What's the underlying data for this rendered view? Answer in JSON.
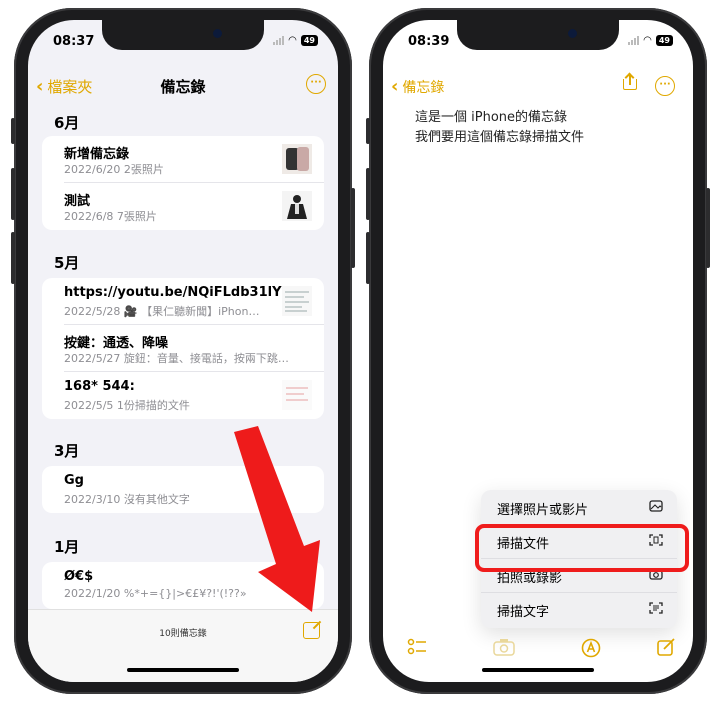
{
  "left": {
    "status_time": "08:37",
    "battery": "49",
    "back_label": "檔案夾",
    "title": "備忘錄",
    "sections": [
      {
        "month": "6月",
        "notes": [
          {
            "title": "新增備忘錄",
            "sub": "2022/6/20  2張照片",
            "thumb": "backpack"
          },
          {
            "title": "測試",
            "sub": "2022/6/8  7張照片",
            "thumb": "person"
          }
        ]
      },
      {
        "month": "5月",
        "notes": [
          {
            "title": "https://youtu.be/NQiFLdb31lY",
            "sub": "2022/5/28  🎥 【果仁聽新聞】iPhon…",
            "thumb": "doc"
          },
          {
            "title": "按鍵：通透、降噪",
            "sub": "2022/5/27  旋鈕：音量、接電話，按兩下跳…",
            "thumb": ""
          },
          {
            "title": "168* 544:",
            "sub": "2022/5/5  1份掃描的文件",
            "thumb": "scan"
          }
        ]
      },
      {
        "month": "3月",
        "notes": [
          {
            "title": "Gg",
            "sub": "2022/3/10  沒有其他文字",
            "thumb": ""
          }
        ]
      },
      {
        "month": "1月",
        "notes": [
          {
            "title": "Ø€$",
            "sub": "2022/1/20  %*+={}|>€£¥?!'(!??»",
            "thumb": ""
          }
        ]
      }
    ],
    "note_count": "10則備忘錄"
  },
  "right": {
    "status_time": "08:39",
    "battery": "49",
    "back_label": "備忘錄",
    "body_lines": [
      "這是一個 iPhone的備忘錄",
      "我們要用這個備忘錄掃描文件"
    ],
    "menu": [
      {
        "label": "選擇照片或影片",
        "icon": "photo-library-icon"
      },
      {
        "label": "掃描文件",
        "icon": "document-scan-icon"
      },
      {
        "label": "拍照或錄影",
        "icon": "camera-icon"
      },
      {
        "label": "掃描文字",
        "icon": "text-scan-icon"
      }
    ]
  },
  "colors": {
    "accent": "#e0a800",
    "highlight": "#ef1c1c",
    "arrow": "#ee1b1b"
  }
}
